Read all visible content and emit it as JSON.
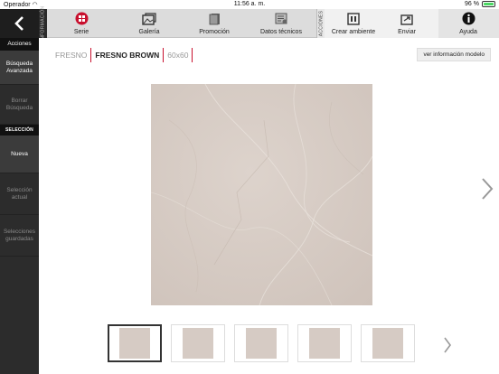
{
  "status": {
    "carrier": "Operador",
    "time": "11:56 a. m.",
    "battery": "96 %"
  },
  "toolbar": {
    "info_tab": "INFORMACIÓN",
    "actions_tab": "ACCIONES",
    "serie": "Serie",
    "galeria": "Galería",
    "promocion": "Promoción",
    "datos": "Datos técnicos",
    "crear": "Crear ambiente",
    "enviar": "Enviar",
    "ayuda": "Ayuda"
  },
  "sidebar": {
    "acciones": "Acciones",
    "busqueda": "Búsqueda Avanzada",
    "borrar": "Borrar Búsqueda",
    "seleccion": "SELECCIÓN",
    "nueva": "Nueva",
    "actual": "Selección actual",
    "guardadas": "Selecciones guardadas"
  },
  "breadcrumb": {
    "serie": "FRESNO",
    "modelo": "FRESNO BROWN",
    "formato": "60x60"
  },
  "info_button": "ver información modelo",
  "colors": {
    "accent": "#c8102e",
    "sidebar": "#2c2c2c",
    "tile": "#d6cbc4"
  },
  "thumbnails_count": 5
}
